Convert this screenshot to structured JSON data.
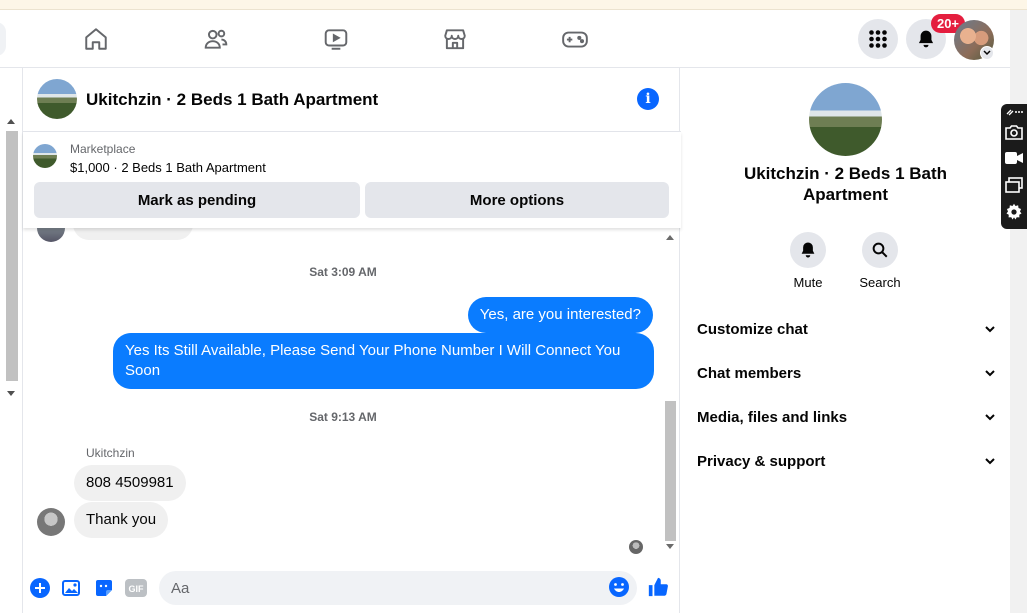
{
  "colors": {
    "accent": "#0866ff",
    "bubble_out": "#0a7cff",
    "bubble_in": "#f0f0f0",
    "badge": "#e41e3f"
  },
  "nav": {
    "icons": [
      "home-icon",
      "friends-icon",
      "watch-icon",
      "marketplace-icon",
      "gaming-icon"
    ],
    "notification_badge": "20+"
  },
  "chat": {
    "title": "Ukitchzin · 2 Beds 1 Bath Apartment",
    "marketplace_label": "Marketplace",
    "listing": "$1,000 · 2 Beds 1 Bath Apartment",
    "mark_pending_label": "Mark as pending",
    "more_options_label": "More options"
  },
  "messages": {
    "timestamp_1": "Sat 3:09 AM",
    "out_1": "Yes, are you interested?",
    "out_2": "Yes Its Still Available, Please Send Your Phone Number I Will Connect You Soon",
    "timestamp_2": "Sat 9:13 AM",
    "sender": "Ukitchzin",
    "in_1": "808 4509981",
    "in_2": "Thank you"
  },
  "composer": {
    "placeholder": "Aa",
    "gif_label": "GIF"
  },
  "info_panel": {
    "name": "Ukitchzin · 2 Beds 1 Bath Apartment",
    "mute_label": "Mute",
    "search_label": "Search",
    "sections": [
      "Customize chat",
      "Chat members",
      "Media, files and links",
      "Privacy & support"
    ]
  }
}
